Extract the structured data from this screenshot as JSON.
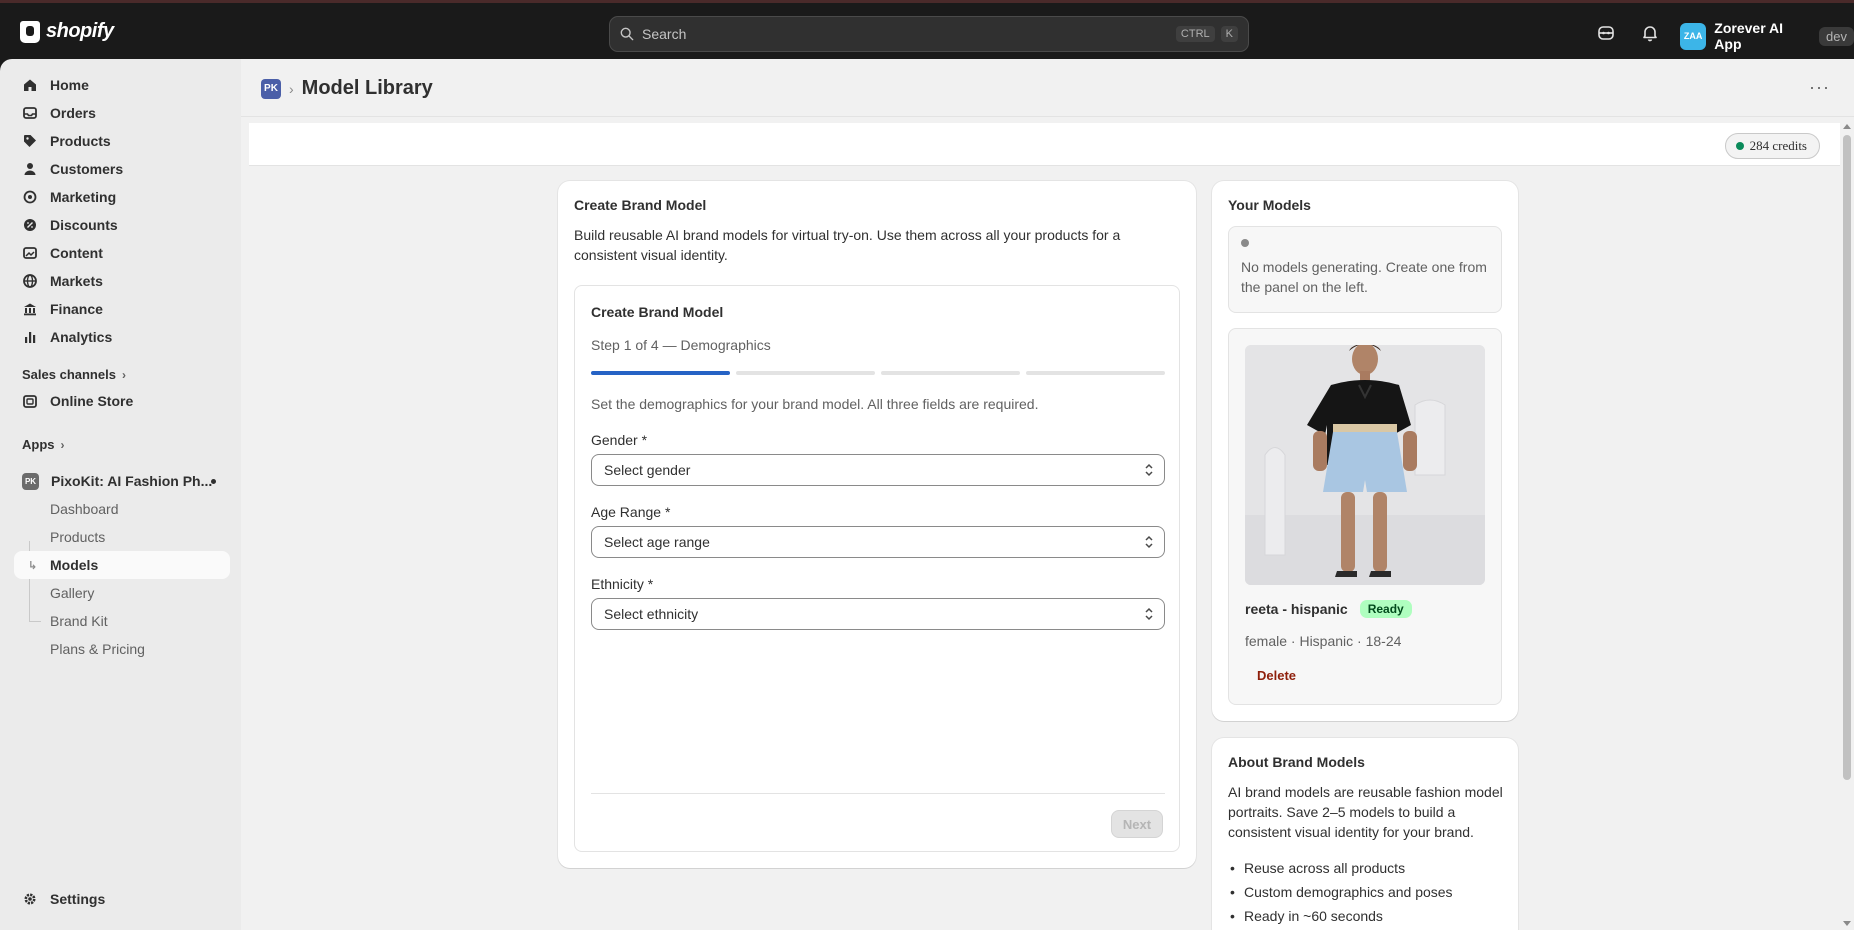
{
  "topbar": {
    "logo_text": "shopify",
    "search_placeholder": "Search",
    "shortcut_ctrl": "CTRL",
    "shortcut_k": "K",
    "store_avatar": "ZAA",
    "store_name": "Zorever AI App",
    "store_badge": "dev"
  },
  "sidebar": {
    "items": [
      {
        "label": "Home",
        "icon": "home-icon"
      },
      {
        "label": "Orders",
        "icon": "inbox-icon"
      },
      {
        "label": "Products",
        "icon": "tag-icon"
      },
      {
        "label": "Customers",
        "icon": "person-icon"
      },
      {
        "label": "Marketing",
        "icon": "target-icon"
      },
      {
        "label": "Discounts",
        "icon": "discount-icon"
      },
      {
        "label": "Content",
        "icon": "image-icon"
      },
      {
        "label": "Markets",
        "icon": "globe-icon"
      },
      {
        "label": "Finance",
        "icon": "bank-icon"
      },
      {
        "label": "Analytics",
        "icon": "bar-chart-icon"
      }
    ],
    "sales_channels_label": "Sales channels",
    "online_store_label": "Online Store",
    "apps_label": "Apps",
    "app_name": "PixoKit: AI Fashion Ph...",
    "app_icon_text": "PK",
    "app_subitems": [
      "Dashboard",
      "Products",
      "Models",
      "Gallery",
      "Brand Kit",
      "Plans & Pricing"
    ],
    "active_subitem": "Models",
    "settings_label": "Settings"
  },
  "page": {
    "app_badge": "PK",
    "breadcrumb_sep": "›",
    "title": "Model Library",
    "more": "···",
    "credits": "284 credits"
  },
  "create_card": {
    "title": "Create Brand Model",
    "description": "Build reusable AI brand models for virtual try-on. Use them across all your products for a consistent visual identity.",
    "inner_title": "Create Brand Model",
    "step_text": "Step 1 of 4 — Demographics",
    "progress_steps_total": 4,
    "progress_current": 1,
    "instructions": "Set the demographics for your brand model. All three fields are required.",
    "fields": [
      {
        "label": "Gender *",
        "value": "Select gender"
      },
      {
        "label": "Age Range *",
        "value": "Select age range"
      },
      {
        "label": "Ethnicity *",
        "value": "Select ethnicity"
      }
    ],
    "next_label": "Next"
  },
  "your_models": {
    "title": "Your Models",
    "generating_text": "No models generating. Create one from the panel on the left.",
    "model": {
      "name": "reeta - hispanic",
      "status": "Ready",
      "meta": "female · Hispanic · 18-24",
      "delete_label": "Delete"
    }
  },
  "about": {
    "title": "About Brand Models",
    "text": "AI brand models are reusable fashion model portraits. Save 2–5 models to build a consistent visual identity for your brand.",
    "bullets": [
      "Reuse across all products",
      "Custom demographics and poses",
      "Ready in ~60 seconds"
    ]
  },
  "colors": {
    "accent": "#2663c5",
    "ready_bg": "#affebf",
    "delete": "#8e1f0b",
    "topbar": "#1a1a1a"
  }
}
